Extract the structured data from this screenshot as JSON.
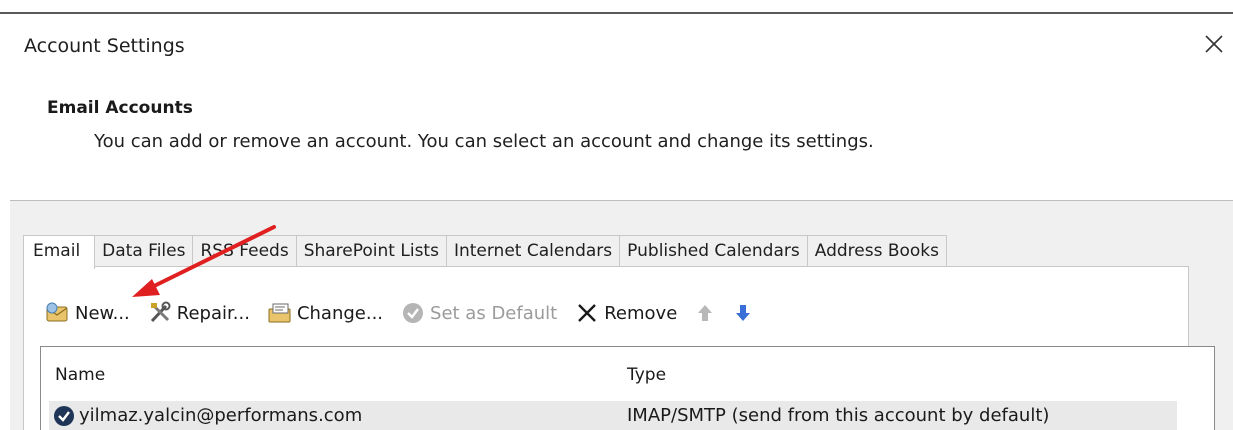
{
  "window": {
    "title": "Account Settings",
    "close_icon": "close-icon"
  },
  "header": {
    "heading": "Email Accounts",
    "description": "You can add or remove an account. You can select an account and change its settings."
  },
  "tabs": [
    {
      "label": "Email",
      "active": true
    },
    {
      "label": "Data Files",
      "active": false
    },
    {
      "label": "RSS Feeds",
      "active": false
    },
    {
      "label": "SharePoint Lists",
      "active": false
    },
    {
      "label": "Internet Calendars",
      "active": false
    },
    {
      "label": "Published Calendars",
      "active": false
    },
    {
      "label": "Address Books",
      "active": false
    }
  ],
  "toolbar": {
    "new_label": "New...",
    "repair_label": "Repair...",
    "change_label": "Change...",
    "set_default_label": "Set as Default",
    "remove_label": "Remove",
    "move_up_icon": "arrow-up-icon",
    "move_down_icon": "arrow-down-icon"
  },
  "accounts_list": {
    "columns": [
      "Name",
      "Type"
    ],
    "rows": [
      {
        "name": "yilmaz.yalcin@performans.com",
        "type": "IMAP/SMTP (send from this account by default)",
        "icon": "default-check-icon"
      }
    ]
  },
  "colors": {
    "annotation_arrow": "#e02020",
    "selected_row": "#e9e9e9",
    "panel_background": "#f0f0f0",
    "move_down_arrow": "#3a6fd8"
  }
}
